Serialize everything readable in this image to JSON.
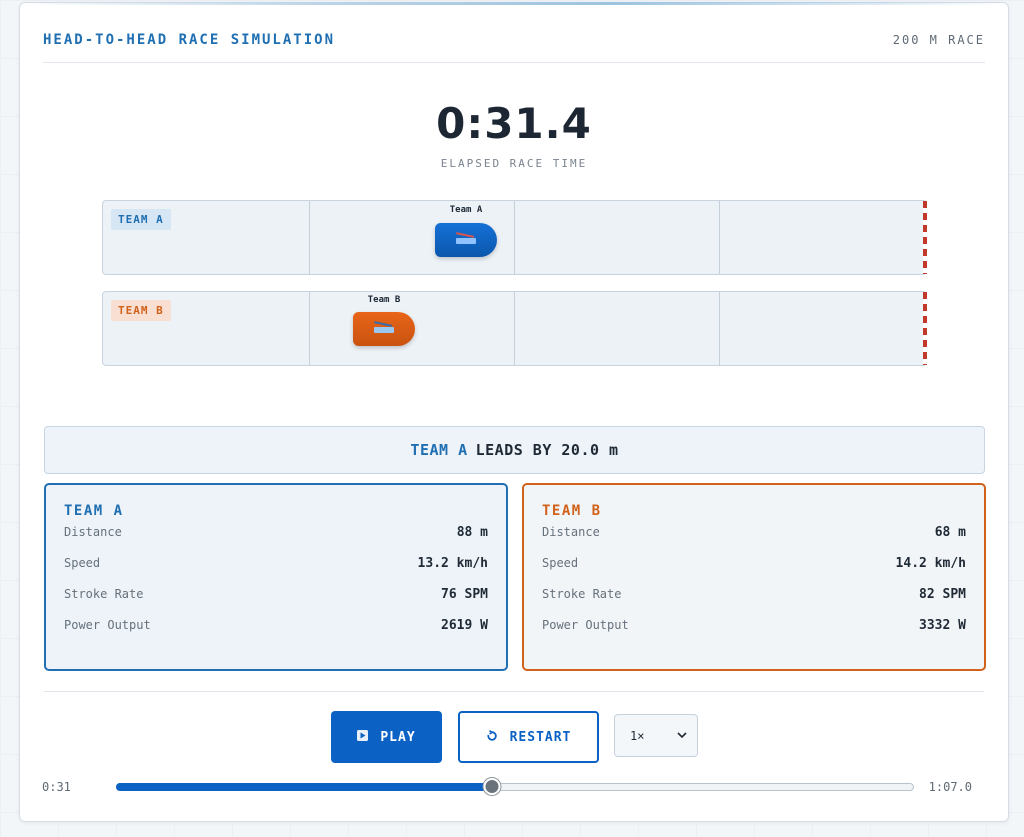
{
  "header": {
    "title": "HEAD-TO-HEAD RACE SIMULATION",
    "race_distance": "200 M RACE"
  },
  "timer": {
    "elapsed": "0:31.4",
    "label": "ELAPSED RACE TIME"
  },
  "lanes": [
    {
      "tag": "TEAM A",
      "boat_label": "Team A",
      "progress": 0.44,
      "color": "#0b62c4"
    },
    {
      "tag": "TEAM B",
      "boat_label": "Team B",
      "progress": 0.34,
      "color": "#e0631c"
    }
  ],
  "lead": {
    "team": "TEAM A",
    "text": "LEADS BY 20.0 m"
  },
  "teams": [
    {
      "name": "TEAM A",
      "color": "#1f6fb2",
      "stats": [
        {
          "label": "Distance",
          "value": "88 m"
        },
        {
          "label": "Speed",
          "value": "13.2 km/h"
        },
        {
          "label": "Stroke Rate",
          "value": "76 SPM"
        },
        {
          "label": "Power Output",
          "value": "2619 W"
        }
      ]
    },
    {
      "name": "TEAM B",
      "color": "#d0621c",
      "stats": [
        {
          "label": "Distance",
          "value": "68 m"
        },
        {
          "label": "Speed",
          "value": "14.2 km/h"
        },
        {
          "label": "Stroke Rate",
          "value": "82 SPM"
        },
        {
          "label": "Power Output",
          "value": "3332 W"
        }
      ]
    }
  ],
  "controls": {
    "play_label": "PLAY",
    "play_icon": "play-icon",
    "restart_label": "RESTART",
    "restart_icon": "restart-icon",
    "speed_value": "1×",
    "speed_icon": "chevron-down-icon"
  },
  "timeline": {
    "current": "0:31",
    "total": "1:07.0",
    "progress": 0.47
  }
}
